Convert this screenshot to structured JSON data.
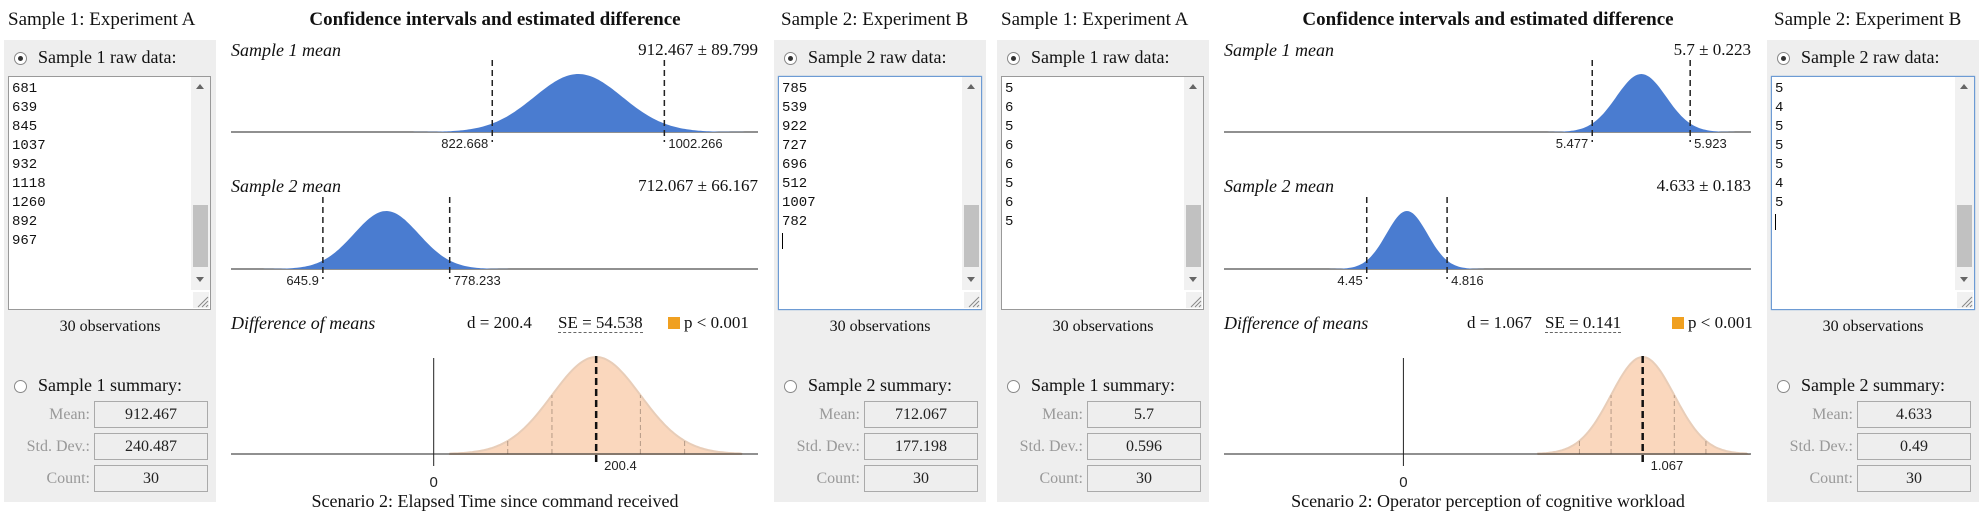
{
  "panels": [
    {
      "sample1": {
        "title": "Sample 1: Experiment A",
        "raw_label": "Sample 1 raw data:",
        "raw_values": [
          "681",
          "639",
          "845",
          "1037",
          "932",
          "1118",
          "1260",
          "892",
          "967"
        ],
        "observations": "30 observations",
        "summary_label": "Sample 1 summary:",
        "mean_label": "Mean:",
        "mean": "912.467",
        "sd_label": "Std. Dev.:",
        "sd": "240.487",
        "count_label": "Count:",
        "count": "30"
      },
      "sample2": {
        "title": "Sample 2: Experiment B",
        "raw_label": "Sample 2 raw data:",
        "raw_values": [
          "785",
          "539",
          "922",
          "727",
          "696",
          "512",
          "1007",
          "782"
        ],
        "observations": "30 observations",
        "summary_label": "Sample 2 summary:",
        "mean_label": "Mean:",
        "mean": "712.067",
        "sd_label": "Std. Dev.:",
        "sd": "177.198",
        "count_label": "Count:",
        "count": "30"
      },
      "chart": {
        "title": "Confidence intervals and estimated difference",
        "mean1_label": "Sample 1 mean",
        "mean1_value": "912.467 ± 89.799",
        "ci1_low": "822.668",
        "ci1_high": "1002.266",
        "mean2_label": "Sample 2 mean",
        "mean2_value": "712.067 ± 66.167",
        "ci2_low": "645.9",
        "ci2_high": "778.233",
        "diff_label": "Difference of means",
        "d_text": "d = 200.4",
        "se_text": "SE = 54.538",
        "p_text": "p < 0.001",
        "zero_label": "0",
        "d_tick": "200.4",
        "caption": "Scenario 2: Elapsed Time since command received"
      },
      "chart_data": {
        "type": "area",
        "ci1": {
          "mean": 912.467,
          "low": 822.668,
          "high": 1002.266
        },
        "ci2": {
          "mean": 712.067,
          "low": 645.9,
          "high": 778.233
        },
        "diff": {
          "d": 200.4,
          "se": 54.538,
          "zero": 0
        },
        "ci_range": [
          550,
          1100
        ],
        "diff_range": [
          -250,
          400
        ]
      }
    },
    {
      "sample1": {
        "title": "Sample 1: Experiment A",
        "raw_label": "Sample 1 raw data:",
        "raw_values": [
          "5",
          "6",
          "5",
          "6",
          "6",
          "5",
          "6",
          "5"
        ],
        "observations": "30 observations",
        "summary_label": "Sample 1 summary:",
        "mean_label": "Mean:",
        "mean": "5.7",
        "sd_label": "Std. Dev.:",
        "sd": "0.596",
        "count_label": "Count:",
        "count": "30"
      },
      "sample2": {
        "title": "Sample 2: Experiment B",
        "raw_label": "Sample 2 raw data:",
        "raw_values": [
          "5",
          "4",
          "5",
          "5",
          "5",
          "4",
          "5"
        ],
        "observations": "30 observations",
        "summary_label": "Sample 2 summary:",
        "mean_label": "Mean:",
        "mean": "4.633",
        "sd_label": "Std. Dev.:",
        "sd": "0.49",
        "count_label": "Count:",
        "count": "30"
      },
      "chart": {
        "title": "Confidence intervals and estimated difference",
        "mean1_label": "Sample 1 mean",
        "mean1_value": "5.7 ± 0.223",
        "ci1_low": "5.477",
        "ci1_high": "5.923",
        "mean2_label": "Sample 2 mean",
        "mean2_value": "4.633 ± 0.183",
        "ci2_low": "4.45",
        "ci2_high": "4.816",
        "diff_label": "Difference of means",
        "d_text": "d = 1.067",
        "se_text": "SE = 0.141",
        "p_text": "p < 0.001",
        "zero_label": "0",
        "d_tick": "1.067",
        "caption": "Scenario 2: Operator perception of cognitive workload"
      },
      "chart_data": {
        "type": "area",
        "ci1": {
          "mean": 5.7,
          "low": 5.477,
          "high": 5.923
        },
        "ci2": {
          "mean": 4.633,
          "low": 4.45,
          "high": 4.816
        },
        "diff": {
          "d": 1.067,
          "se": 0.141,
          "zero": 0
        },
        "ci_range": [
          3.8,
          6.2
        ],
        "diff_range": [
          -0.8,
          1.55
        ]
      }
    }
  ],
  "colors": {
    "ci_fill": "#4a7cd0",
    "diff_fill": "#fad7bd",
    "p_badge": "#f0a020"
  }
}
